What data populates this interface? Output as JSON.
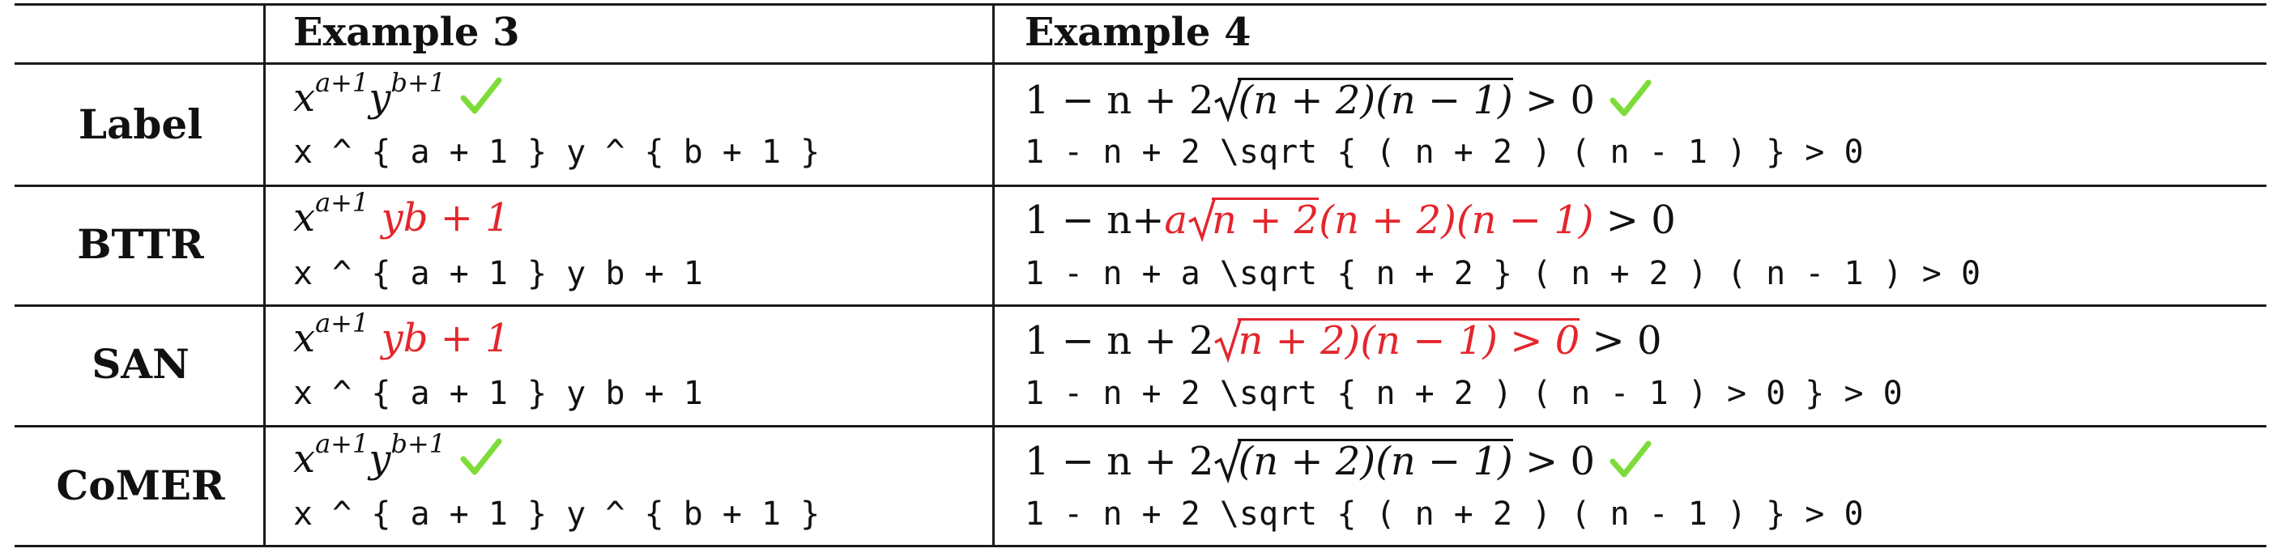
{
  "table": {
    "headers": [
      "Example 3",
      "Example 4"
    ],
    "rows": [
      {
        "label": "Label",
        "ex3_latex": "x ^ { a + 1 } y ^ { b + 1 }",
        "ex4_latex": "1 - n + 2 \\sqrt { ( n + 2 ) ( n - 1 ) } > 0",
        "ex3_correct": true,
        "ex4_correct": true
      },
      {
        "label": "BTTR",
        "ex3_latex": "x ^ { a + 1 } y b + 1",
        "ex4_latex": "1 - n + a \\sqrt { n + 2 } ( n + 2 ) ( n - 1 ) > 0",
        "ex3_correct": false,
        "ex4_correct": false
      },
      {
        "label": "SAN",
        "ex3_latex": "x ^ { a + 1 } y b + 1",
        "ex4_latex": "1 - n + 2 \\sqrt { n + 2 ) ( n - 1 ) > 0 } > 0",
        "ex3_correct": false,
        "ex4_correct": false
      },
      {
        "label": "CoMER",
        "ex3_latex": "x ^ { a + 1 } y ^ { b + 1 }",
        "ex4_latex": "1 - n + 2 \\sqrt { ( n + 2 ) ( n - 1 ) } > 0",
        "ex3_correct": true,
        "ex4_correct": true
      }
    ]
  },
  "rendered": {
    "x": "x",
    "a1": "a+1",
    "y": "y",
    "b1": "b+1",
    "yb1": "yb + 1",
    "one_minus_n": "1 − n",
    "plus2": " + 2",
    "plus": "+",
    "a": "a",
    "n2_paren": "(n + 2)(n − 1)",
    "n2": "n + 2",
    "gt0": " > 0",
    "san_rad": "n + 2)(n − 1) > 0"
  },
  "colors": {
    "error": "#e3262c",
    "check": "#7ddc3a",
    "rule": "#1a1a1a"
  },
  "icons": {
    "correct": "green-checkmark-icon"
  }
}
